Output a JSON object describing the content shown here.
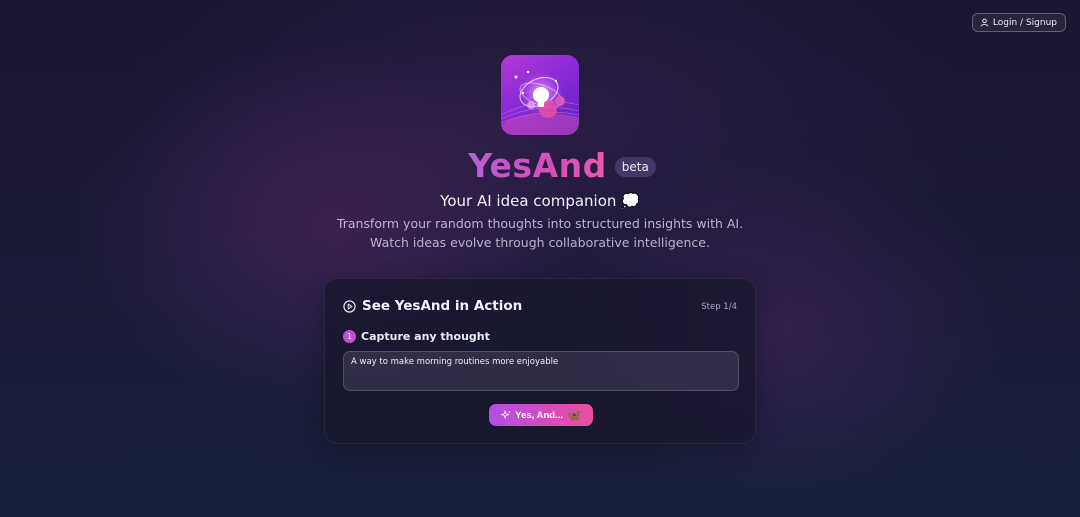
{
  "header": {
    "login_label": "Login / Signup"
  },
  "hero": {
    "title": "YesAnd",
    "badge": "beta",
    "subtitle": "Your AI idea companion 💭",
    "description_line1": "Transform your random thoughts into structured insights with AI.",
    "description_line2": "Watch ideas evolve through collaborative intelligence."
  },
  "demo": {
    "title": "See YesAnd in Action",
    "step": "Step 1/4",
    "step_number": "1",
    "step_label": "Capture any thought",
    "thought_value": "A way to make morning routines more enjoyable",
    "button_label": "Yes, And...",
    "button_emoji": "🦋"
  },
  "icons": {
    "login": "user-icon",
    "logo": "lightbulb-logo-icon",
    "demo": "play-circle-icon",
    "button": "sparkles-icon"
  },
  "colors": {
    "accent_start": "#b14fe6",
    "accent_end": "#e94f9f",
    "background": "#1b1a35"
  }
}
